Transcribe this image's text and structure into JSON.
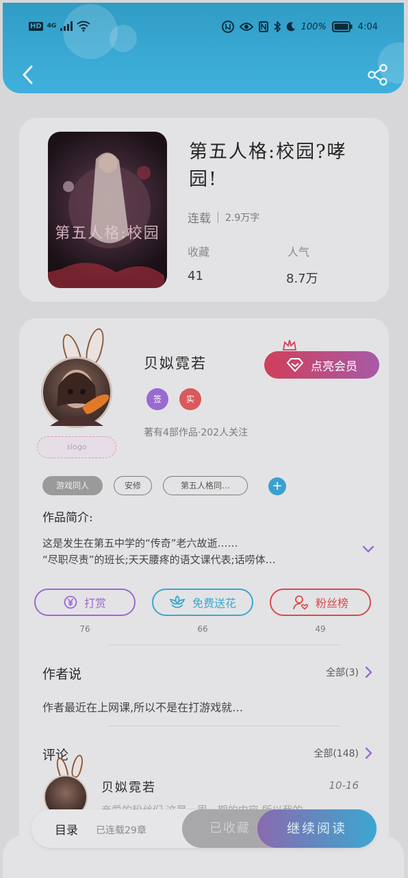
{
  "status_bar": {
    "network": "4G",
    "battery": "100%",
    "time": "4:04"
  },
  "book": {
    "title": "第五人格:校园?哮园!",
    "status": "连载",
    "word_count": "2.9万字",
    "collect_label": "收藏",
    "collect_value": "41",
    "popularity_label": "人气",
    "popularity_value": "8.7万",
    "cover_text": "第五人格:校园"
  },
  "author": {
    "name": "贝姒霓若",
    "badges": [
      "签",
      "实"
    ],
    "stats": "著有4部作品·202人关注",
    "vip_button": "点亮会员",
    "logo_text": "slogo"
  },
  "tags": [
    "游戏同人",
    "安修",
    "第五人格同…"
  ],
  "intro": {
    "label": "作品简介:",
    "line1": "这是发生在第五中学的“传奇”老六故逝……",
    "line2": "“尽职尽责”的班长;天天腰疼的语文课代表;话唠体…"
  },
  "actions": [
    {
      "label": "打赏",
      "count": "76"
    },
    {
      "label": "免费送花",
      "count": "66"
    },
    {
      "label": "粉丝榜",
      "count": "49"
    }
  ],
  "author_says": {
    "title": "作者说",
    "link": "全部(3)",
    "text": "作者最近在上网课,所以不是在打游戏就…"
  },
  "comments": {
    "title": "评论",
    "link": "全部(148)",
    "first": {
      "name": "贝姒霓若",
      "date": "10-16",
      "text": "亲爱的粉丝们,这是一周一期的内容,所以我的…"
    }
  },
  "bottom_bar": {
    "toc_label": "目录",
    "toc_sub": "已连载29章",
    "collected": "已收藏",
    "continue": "继续阅读"
  },
  "colors": {
    "header": "#3aa9d4",
    "vip_start": "#cf3f5a",
    "vip_end": "#a85aa8",
    "tip": "#9a6ad0",
    "flower": "#3ba7cf",
    "fans": "#d84a4a"
  }
}
